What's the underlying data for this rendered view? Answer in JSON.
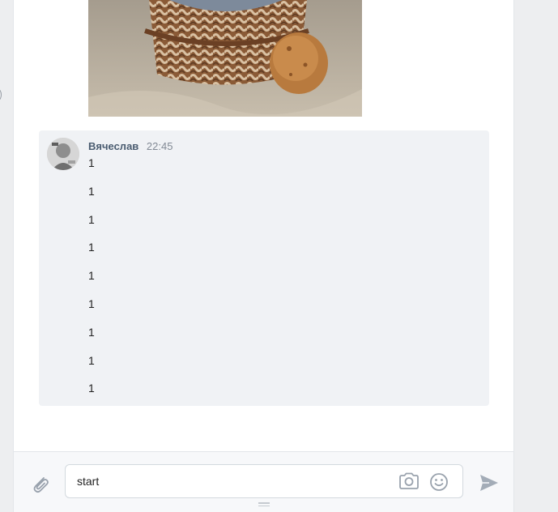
{
  "message": {
    "author": "Вячеслав",
    "time": "22:45",
    "lines": [
      "1",
      "1",
      "1",
      "1",
      "1",
      "1",
      "1",
      "1",
      "1"
    ]
  },
  "composer": {
    "input_value": "start",
    "icons": {
      "attach": "paperclip-icon",
      "camera": "camera-icon",
      "emoji": "smile-icon",
      "send": "send-icon"
    }
  },
  "colors": {
    "message_bg": "#f0f2f5",
    "author": "#4a5c70",
    "time": "#828a95",
    "icon": "#99a2ad"
  }
}
